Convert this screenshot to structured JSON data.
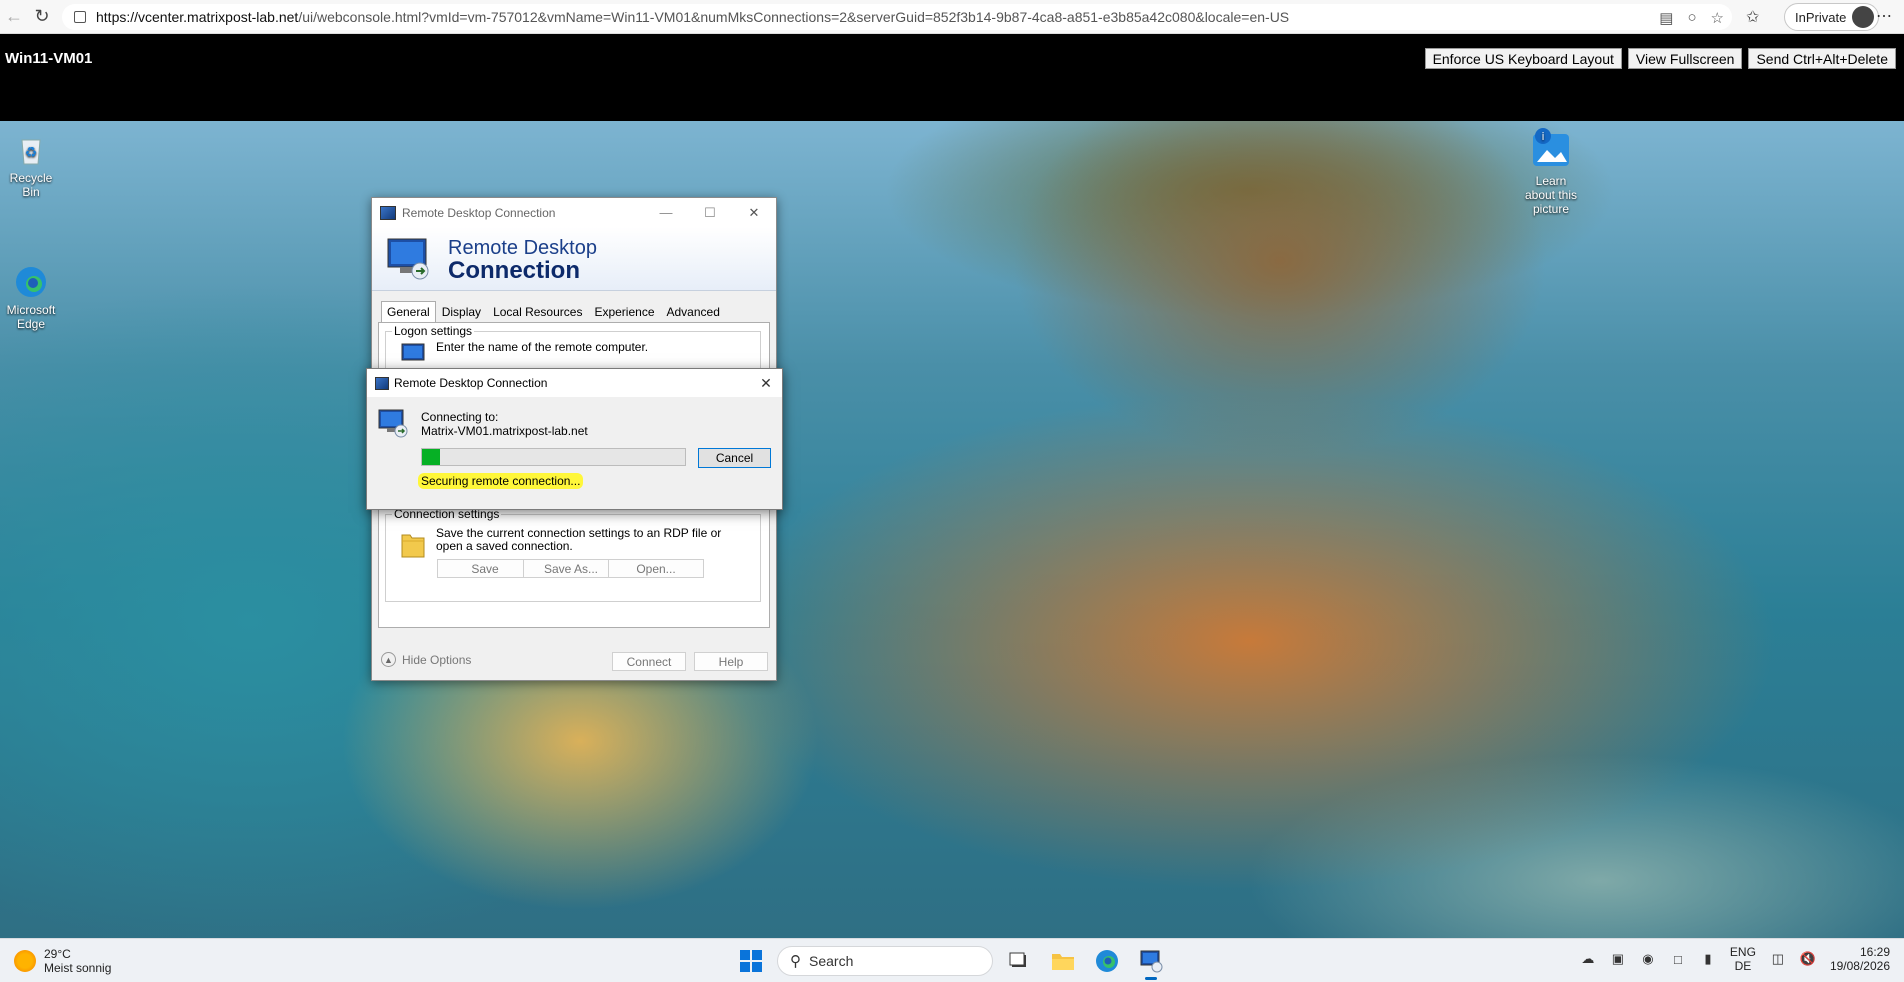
{
  "browser": {
    "url_host": "https://vcenter.matrixpost-lab.net",
    "url_path": "/ui/webconsole.html?vmId=vm-757012&vmName=Win11-VM01&numMksConnections=2&serverGuid=852f3b14-9b87-4ca8-a851-e3b85a42c080&locale=en-US",
    "inprivate_label": "InPrivate"
  },
  "console": {
    "vm_name": "Win11-VM01",
    "buttons": [
      "Enforce US Keyboard Layout",
      "View Fullscreen",
      "Send Ctrl+Alt+Delete"
    ]
  },
  "desktop": {
    "icons": {
      "recycle_bin": "Recycle Bin",
      "edge": "Microsoft Edge",
      "learn_picture": "Learn about this picture"
    }
  },
  "rdc": {
    "title": "Remote Desktop Connection",
    "banner_line1": "Remote Desktop",
    "banner_line2": "Connection",
    "tabs": [
      "General",
      "Display",
      "Local Resources",
      "Experience",
      "Advanced"
    ],
    "logon_group": "Logon settings",
    "logon_hint": "Enter the name of the remote computer.",
    "conn_group": "Connection settings",
    "conn_text": "Save the current connection settings to an RDP file or open a saved connection.",
    "save": "Save",
    "save_as": "Save As...",
    "open": "Open...",
    "hide_options": "Hide Options",
    "connect": "Connect",
    "help": "Help"
  },
  "dialog": {
    "title": "Remote Desktop Connection",
    "connecting_to": "Connecting to:",
    "host": "Matrix-VM01.matrixpost-lab.net",
    "cancel": "Cancel",
    "status": "Securing remote connection...",
    "progress": 0.07
  },
  "taskbar": {
    "temperature": "29°C",
    "condition": "Meist sonnig",
    "search_placeholder": "Search",
    "lang_top": "ENG",
    "lang_bottom": "DE",
    "time": "16:29",
    "date": "19/08/2026"
  },
  "colors": {
    "progress_green": "#06b025",
    "highlight_yellow": "#fff73a",
    "accent_blue": "#0078d7"
  }
}
